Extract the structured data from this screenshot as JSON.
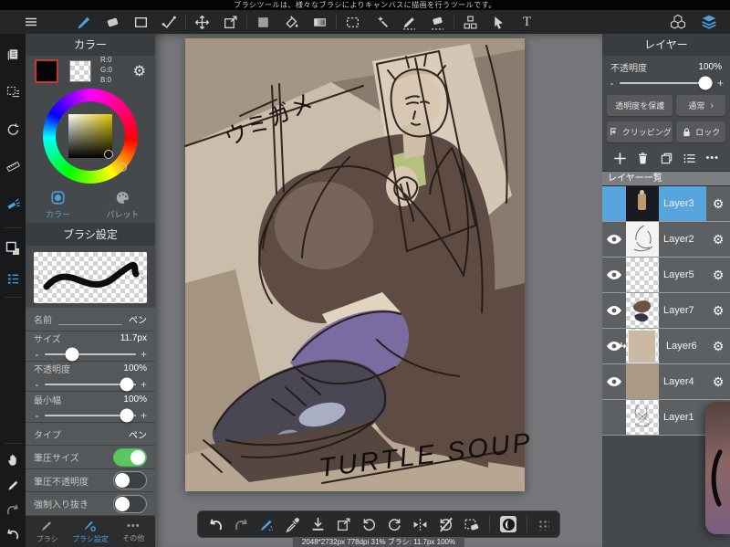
{
  "info_bar": {
    "hint": "ブラシツールは、様々なブラシによりキャンバスに描画を行うツールです。"
  },
  "glyphs": {
    "gear": "⚙",
    "more": "•••",
    "chevron": "›",
    "minus": "-",
    "plus": "+",
    "undo": "↶",
    "redo": "↷",
    "rotate_left": "↺",
    "rotate_right": "↻",
    "text_tool": "T",
    "arrow_left": "‹",
    "arrow_right": "›"
  },
  "color_panel": {
    "title": "カラー",
    "rgb": [
      "R:0",
      "G:0",
      "B:0"
    ],
    "tab_color": "カラー",
    "tab_palette": "パレット"
  },
  "brush_panel": {
    "title": "ブラシ設定",
    "rows": {
      "name": {
        "label": "名前",
        "value": "ペン"
      },
      "size": {
        "label": "サイズ",
        "value": "11.7px"
      },
      "opacity": {
        "label": "不透明度",
        "value": "100%"
      },
      "min_width": {
        "label": "最小幅",
        "value": "100%"
      },
      "type": {
        "label": "タイプ",
        "value": "ペン"
      },
      "pressure_size": {
        "label": "筆圧サイズ"
      },
      "pressure_opacity": {
        "label": "筆圧不透明度"
      },
      "taper": {
        "label": "強制入り抜き"
      }
    }
  },
  "left_tabbar": {
    "brush": "ブラシ",
    "brush_settings": "ブラシ設定",
    "other": "その他"
  },
  "layers_panel": {
    "title": "レイヤー",
    "opacity_label": "不透明度",
    "opacity_value": "100%",
    "protect_alpha": "透明度を保護",
    "blend_mode": "通常",
    "clipping": "クリッピング",
    "lock": "ロック",
    "list_title": "レイヤー一覧",
    "layers": [
      {
        "name": "Layer3",
        "selected": true,
        "eye": false
      },
      {
        "name": "Layer2",
        "selected": false,
        "eye": true
      },
      {
        "name": "Layer5",
        "selected": false,
        "eye": true
      },
      {
        "name": "Layer7",
        "selected": false,
        "eye": true
      },
      {
        "name": "Layer6",
        "selected": false,
        "eye": true,
        "clipped": true
      },
      {
        "name": "Layer4",
        "selected": false,
        "eye": true
      },
      {
        "name": "Layer1",
        "selected": false,
        "eye": false
      }
    ]
  },
  "canvas": {
    "text_jp": "ウミガメ",
    "text_en": "TURTLE SOUP"
  },
  "status_bar": {
    "text": "2048*2732px 778dpi 31% ブラシ: 11.7px 100%"
  },
  "colors": {
    "accent": "#4da3dc",
    "toggle_on": "#5bc75f",
    "selected_layer": "#57a5dc",
    "swatch_border": "#c43b2e"
  }
}
